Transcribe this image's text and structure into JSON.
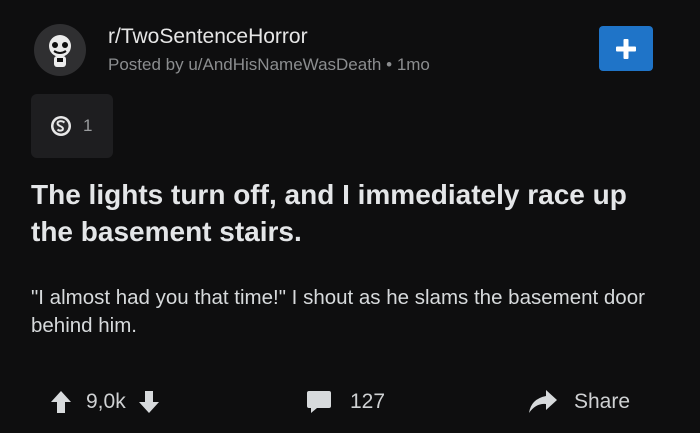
{
  "post": {
    "subreddit": "r/TwoSentenceHorror",
    "posted_by": "Posted by u/AndHisNameWasDeath",
    "separator": "•",
    "age": "1mo",
    "award_count": "1",
    "title": "The lights turn off, and I immediately race up the basement stairs.",
    "body": "\"I almost had you that time!\" I shout as he slams the basement door behind him."
  },
  "actions": {
    "vote_count": "9,0k",
    "comment_count": "127",
    "share_label": "Share"
  },
  "icons": {
    "avatar": "subreddit-avatar-icon",
    "join": "plus-icon",
    "award": "award-icon",
    "upvote": "upvote-arrow-icon",
    "downvote": "downvote-arrow-icon",
    "comment": "comment-bubble-icon",
    "share": "share-arrow-icon"
  },
  "colors": {
    "background": "#0e0e0f",
    "accent": "#1f74c8",
    "text": "#d7dadc",
    "muted": "#8b8d8f"
  }
}
